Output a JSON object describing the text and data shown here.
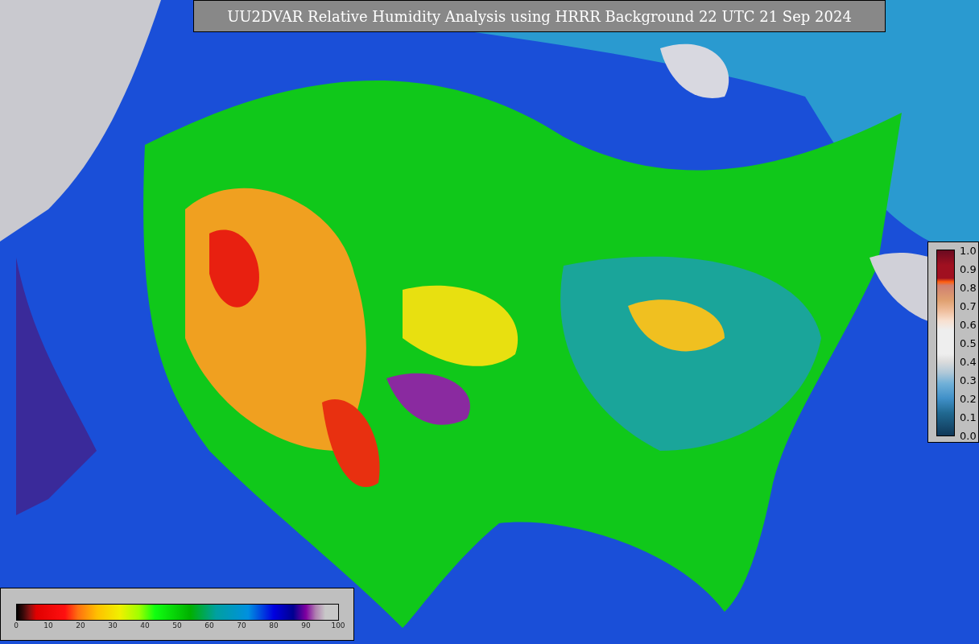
{
  "title": "UU2DVAR Relative Humidity Analysis using HRRR Background 22 UTC 21 Sep 2024",
  "humidity_colorbar": {
    "ticks": [
      "0",
      "10",
      "20",
      "30",
      "40",
      "50",
      "60",
      "70",
      "80",
      "90",
      "100"
    ]
  },
  "fraction_colorbar": {
    "ticks": [
      "1.0",
      "0.9",
      "0.8",
      "0.7",
      "0.6",
      "0.5",
      "0.4",
      "0.3",
      "0.2",
      "0.1",
      "0.0"
    ]
  }
}
